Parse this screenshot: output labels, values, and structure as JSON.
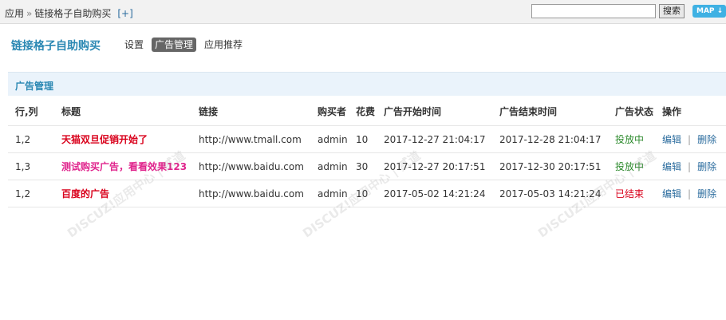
{
  "topbar": {
    "crumbs": [
      "应用",
      "链接格子自助购买"
    ],
    "crumb_sep": "»",
    "add_label": "[+]",
    "search_placeholder": "",
    "search_button": "搜索",
    "map_label": "MAP"
  },
  "header": {
    "app_title": "链接格子自助购买",
    "nav": [
      {
        "label": "设置",
        "active": false
      },
      {
        "label": "广告管理",
        "active": true
      },
      {
        "label": "应用推荐",
        "active": false
      }
    ]
  },
  "panel": {
    "title": "广告管理"
  },
  "table": {
    "columns": {
      "pos": "行,列",
      "title": "标题",
      "link": "链接",
      "buyer": "购买者",
      "cost": "花费",
      "start": "广告开始时间",
      "end": "广告结束时间",
      "status": "广告状态",
      "ops": "操作"
    },
    "rows": [
      {
        "pos": "1,2",
        "title": "天猫双旦促销开始了",
        "title_color": "#d9001b",
        "link": "http://www.tmall.com",
        "buyer": "admin",
        "cost": "10",
        "start": "2017-12-27 21:04:17",
        "end": "2017-12-28 21:04:17",
        "status": "投放中",
        "status_color": "#2e8b2e",
        "edit": "编辑",
        "delete": "删除"
      },
      {
        "pos": "1,3",
        "title": "测试购买广告，看看效果123",
        "title_color": "#e0258d",
        "link": "http://www.baidu.com",
        "buyer": "admin",
        "cost": "30",
        "start": "2017-12-27 20:17:51",
        "end": "2017-12-30 20:17:51",
        "status": "投放中",
        "status_color": "#2e8b2e",
        "edit": "编辑",
        "delete": "删除"
      },
      {
        "pos": "1,2",
        "title": "百度的广告",
        "title_color": "#d9001b",
        "link": "http://www.baidu.com",
        "buyer": "admin",
        "cost": "10",
        "start": "2017-05-02 14:21:24",
        "end": "2017-05-03 14:21:24",
        "status": "已结束",
        "status_color": "#d9001b",
        "edit": "编辑",
        "delete": "删除"
      }
    ]
  },
  "watermarks": [
    "DISCUZ!应用中心 | 贰道",
    "DISCUZ!应用中心 | 贰道",
    "DISCUZ!应用中心 | 贰道"
  ]
}
